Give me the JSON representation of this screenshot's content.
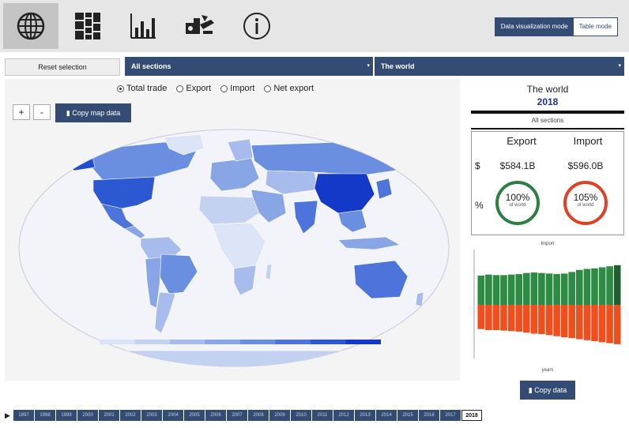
{
  "toolbar": {
    "tools": [
      {
        "name": "map-icon"
      },
      {
        "name": "treemap-icon"
      },
      {
        "name": "bar-chart-icon"
      },
      {
        "name": "trade-flow-icon"
      },
      {
        "name": "info-icon"
      }
    ],
    "modes": {
      "active": "Data visualization mode",
      "inactive": "Table mode"
    }
  },
  "filters": {
    "reset_label": "Reset selection",
    "sections_value": "All sections",
    "partner_value": "The world"
  },
  "map_panel": {
    "flow_options": [
      {
        "label": "Total trade",
        "selected": true
      },
      {
        "label": "Export",
        "selected": false
      },
      {
        "label": "Import",
        "selected": false
      },
      {
        "label": "Net export",
        "selected": false
      }
    ],
    "zoom_in": "+",
    "zoom_out": "-",
    "copy_map_label": "Copy map data",
    "ocean_color": "#f3f3fa",
    "legend_colors": [
      "#dce5f7",
      "#c4d2f2",
      "#a7bced",
      "#88a5e6",
      "#6a8ee0",
      "#4d74da",
      "#2c58d2",
      "#1438c8"
    ]
  },
  "summary": {
    "region": "The world",
    "year": "2018",
    "product": "All sections",
    "export_label": "Export",
    "import_label": "Import",
    "currency_symbol": "$",
    "percent_symbol": "%",
    "export_value": "$584.1B",
    "import_value": "$596.0B",
    "export_pct": "100%",
    "import_pct": "105%",
    "of_world": "of world",
    "chart_title": "Import",
    "chart_xlabel": "years",
    "copy_data_label": "Copy data"
  },
  "chart_data": {
    "type": "bar",
    "title": "",
    "xlabel": "",
    "ylabel": "",
    "series": [
      {
        "values": [
          0.56,
          0.58,
          0.57,
          0.57,
          0.58,
          0.59,
          0.61,
          0.62,
          0.61,
          0.6,
          0.59,
          0.6,
          0.63,
          0.67,
          0.69,
          0.7,
          0.72,
          0.74,
          0.76
        ],
        "color": "#2e8b43"
      },
      {
        "values": [
          -0.48,
          -0.5,
          -0.5,
          -0.51,
          -0.52,
          -0.53,
          -0.55,
          -0.57,
          -0.58,
          -0.6,
          -0.62,
          -0.64,
          -0.66,
          -0.68,
          -0.7,
          -0.72,
          -0.74,
          -0.76,
          -0.78
        ],
        "color": "#f04f1d"
      }
    ],
    "highlight_color": "#1f5f30"
  },
  "years": {
    "list": [
      "1997",
      "1998",
      "1999",
      "2000",
      "2001",
      "2002",
      "2003",
      "2004",
      "2005",
      "2006",
      "2007",
      "2008",
      "2009",
      "2010",
      "2011",
      "2012",
      "2013",
      "2014",
      "2015",
      "2016",
      "2017",
      "2018"
    ],
    "selected": "2018"
  }
}
